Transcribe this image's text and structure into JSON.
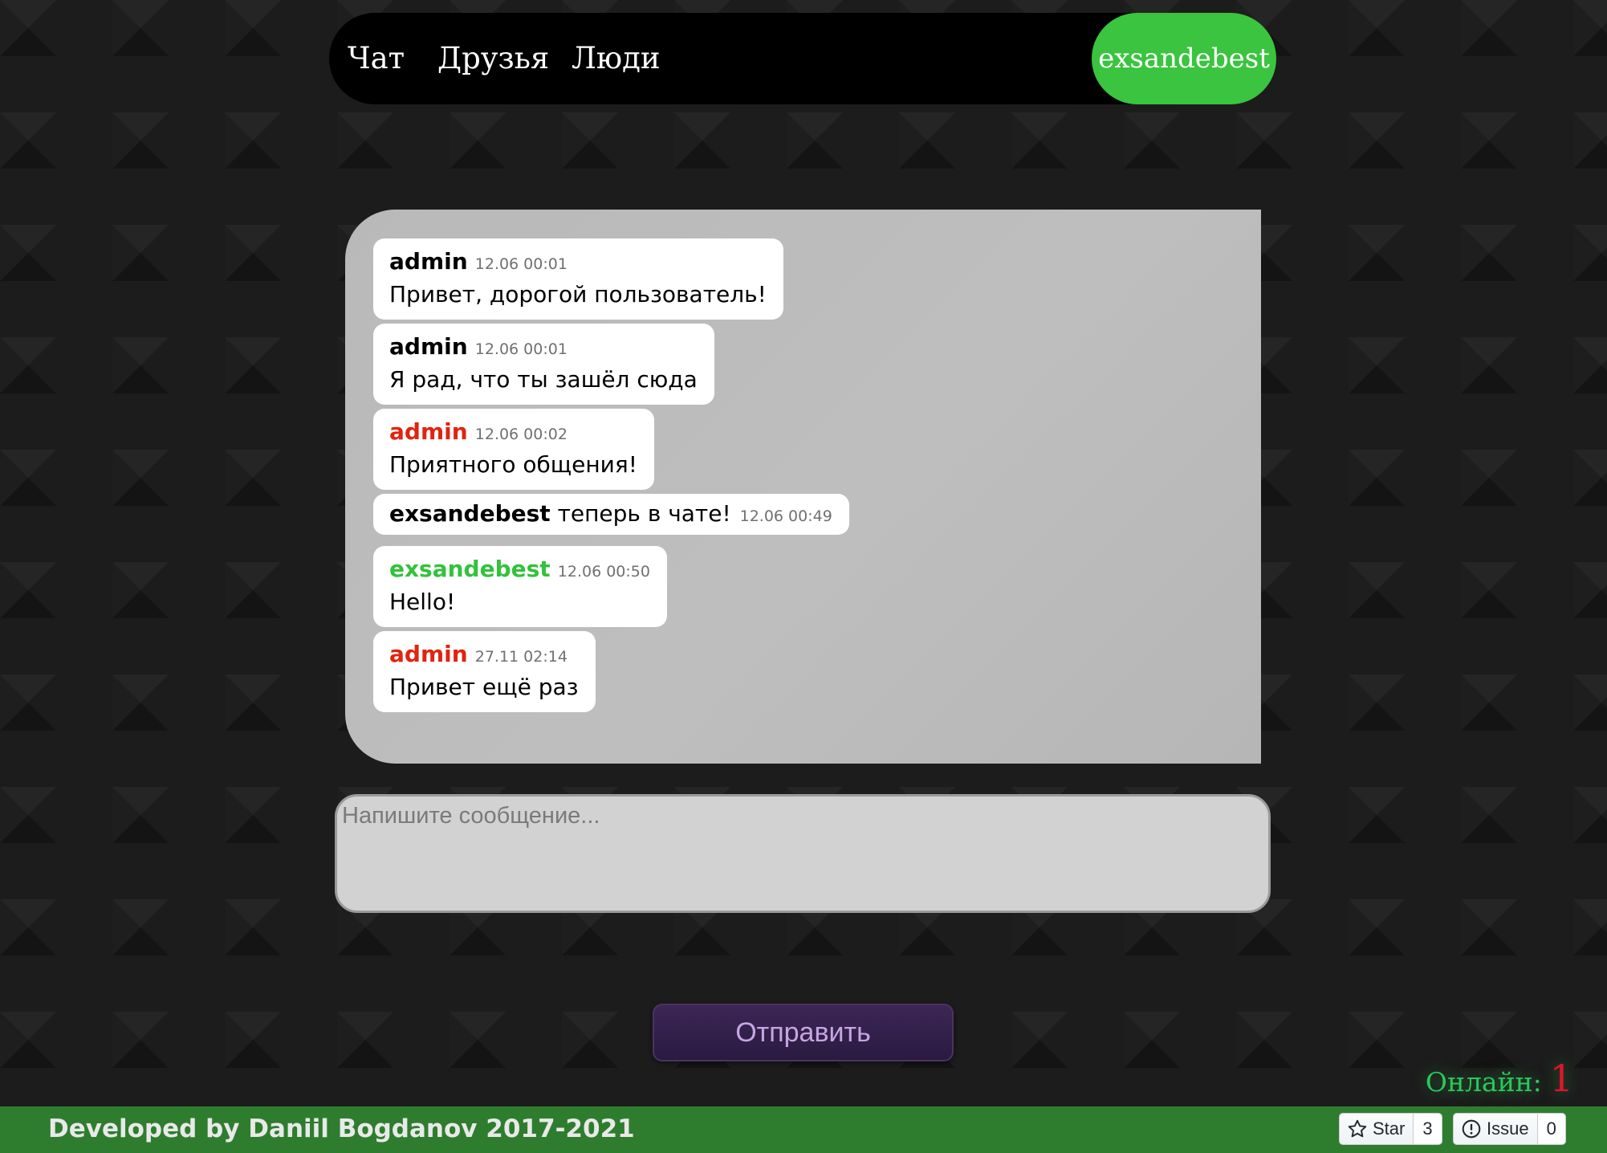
{
  "nav": {
    "links": [
      "Чат",
      "Друзья",
      "Люди"
    ],
    "user": "exsandebest",
    "user_color": "#3ac43f"
  },
  "messages": [
    {
      "author": "admin",
      "time": "12.06 00:01",
      "text": "Привет, дорогой пользователь!",
      "author_color": "#000000"
    },
    {
      "author": "admin",
      "time": "12.06 00:01",
      "text": "Я рад, что ты зашёл сюда",
      "author_color": "#000000"
    },
    {
      "author": "admin",
      "time": "12.06 00:02",
      "text": "Приятного общения!",
      "author_color": "#e0240f"
    },
    {
      "system": true,
      "user": "exsandebest",
      "text": "теперь в чате!",
      "time": "12.06 00:49"
    },
    {
      "author": "exsandebest",
      "time": "12.06 00:50",
      "text": "Hello!",
      "author_color": "#33c23b"
    },
    {
      "author": "admin",
      "time": "27.11 02:14",
      "text": "Привет ещё раз",
      "author_color": "#e0240f"
    }
  ],
  "composer": {
    "placeholder": "Напишите сообщение...",
    "value": ""
  },
  "send_button": "Отправить",
  "online": {
    "label": "Онлайн:",
    "count": "1"
  },
  "footer": {
    "text": "Developed by Daniil Bogdanov 2017-2021",
    "star_label": "Star",
    "star_count": "3",
    "issue_label": "Issue",
    "issue_count": "0",
    "bar_color": "#2e7d2e"
  }
}
